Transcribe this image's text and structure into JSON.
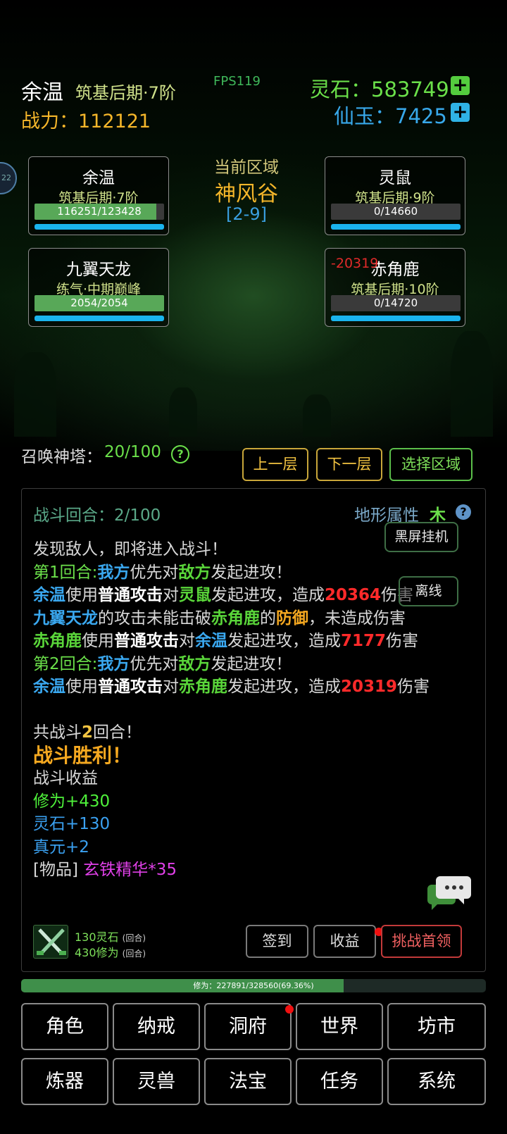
{
  "header": {
    "player_name": "余温",
    "player_realm": "筑基后期·7阶",
    "fps": "FPS119",
    "power": "战力：112121",
    "spirit_stone": "灵石：583749",
    "immortal_jade": "仙玉：7425",
    "plus": "+"
  },
  "side_tab": "22",
  "zone": {
    "label": "当前区域",
    "name": "神风谷",
    "code": "[2-9]"
  },
  "allies": [
    {
      "name": "余温",
      "realm": "筑基后期·7阶",
      "hp_text": "116251/123428",
      "hp_ratio": 0.942
    },
    {
      "name": "九翼天龙",
      "realm": "练气·中期巅峰",
      "hp_text": "2054/2054",
      "hp_ratio": 1.0
    }
  ],
  "enemies": [
    {
      "name": "灵鼠",
      "realm": "筑基后期·9阶",
      "hp_text": "0/14660",
      "hp_ratio": 0
    },
    {
      "name": "赤角鹿",
      "realm": "筑基后期·10阶",
      "hp_text": "0/14720",
      "hp_ratio": 0,
      "damage": "-20319"
    }
  ],
  "tower": {
    "label": "召唤神塔：",
    "value": "20/100",
    "help": "?",
    "prev": "上一层",
    "next": "下一层",
    "select": "选择区域"
  },
  "battle": {
    "round_label": "战斗回合：2/100",
    "terrain_label": "地形属性",
    "terrain_value": "木",
    "help": "?",
    "afk_button": "黑屏挂机",
    "offline_button": "离线",
    "log": {
      "l1": "发现敌人，即将进入战斗！",
      "l2_a": "第1回合:",
      "l2_b": "我方",
      "l2_c": "优先对",
      "l2_d": "敌方",
      "l2_e": "发起进攻！",
      "l3_a": "余温",
      "l3_b": "使用",
      "l3_c": "普通攻击",
      "l3_d": "对",
      "l3_e": "灵鼠",
      "l3_f": "发起进攻，造成",
      "l3_g": "20364",
      "l3_h": "伤害",
      "l4_a": "九翼天龙",
      "l4_b": "的攻击未能击破",
      "l4_c": "赤角鹿",
      "l4_d": "的",
      "l4_e": "防御",
      "l4_f": "，未造成伤害",
      "l5_a": "赤角鹿",
      "l5_b": "使用",
      "l5_c": "普通攻击",
      "l5_d": "对",
      "l5_e": "余温",
      "l5_f": "发起进攻，造成",
      "l5_g": "7177",
      "l5_h": "伤害",
      "l6_a": "第2回合:",
      "l6_b": "我方",
      "l6_c": "优先对",
      "l6_d": "敌方",
      "l6_e": "发起进攻！",
      "l7_a": "余温",
      "l7_b": "使用",
      "l7_c": "普通攻击",
      "l7_d": "对",
      "l7_e": "赤角鹿",
      "l7_f": "发起进攻，造成",
      "l7_g": "20319",
      "l7_h": "伤害",
      "l8_a": "共战斗",
      "l8_b": "2",
      "l8_c": "回合！",
      "victory": "战斗胜利！",
      "rewards_title": "战斗收益",
      "r1": "修为+430",
      "r2": "灵石+130",
      "r3": "真元+2",
      "r4_a": "[物品]",
      "r4_b": "玄铁精华*35"
    },
    "rate1_val": "130灵石",
    "rate1_unit": "(回合)",
    "rate2_val": "430修为",
    "rate2_unit": "(回合)",
    "checkin": "签到",
    "income": "收益",
    "challenge": "挑战首领"
  },
  "exp_bar": {
    "text": "修为：227891/328560(69.36%)",
    "ratio": 0.6936
  },
  "menu": [
    {
      "label": "角色"
    },
    {
      "label": "纳戒"
    },
    {
      "label": "洞府",
      "dot": true
    },
    {
      "label": "世界"
    },
    {
      "label": "坊市"
    },
    {
      "label": "炼器"
    },
    {
      "label": "灵兽"
    },
    {
      "label": "法宝"
    },
    {
      "label": "任务"
    },
    {
      "label": "系统"
    }
  ],
  "colors": {
    "accent_gold": "#f5b62a",
    "accent_green": "#6be04a",
    "accent_blue": "#38a8ea",
    "damage_red": "#ff2a2a"
  },
  "icons": {
    "chat": "chat-bubbles-icon",
    "sword": "crossed-swords-icon"
  }
}
